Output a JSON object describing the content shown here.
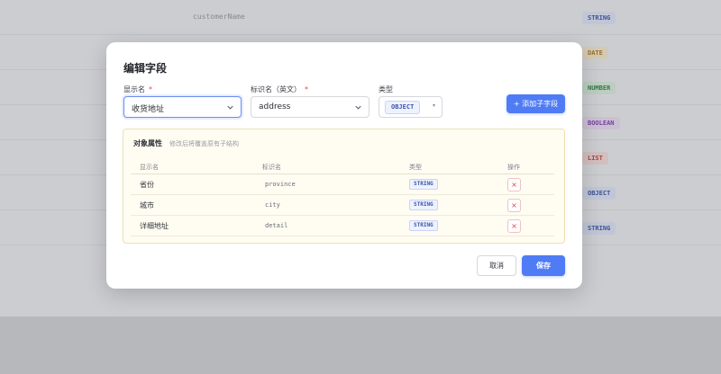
{
  "background": {
    "rows": [
      {
        "code": "customerName",
        "type": "STRING",
        "color": "#3d56a8",
        "bg": "#e4e9fb"
      },
      {
        "code": "",
        "type": "DATE",
        "color": "#b57a14",
        "bg": "#fbefd2"
      },
      {
        "code": "",
        "type": "NUMBER",
        "color": "#2f8a3e",
        "bg": "#dff2e2"
      },
      {
        "code": "",
        "type": "BOOLEAN",
        "color": "#8a3fb5",
        "bg": "#f0e2f8"
      },
      {
        "code": "",
        "type": "LIST",
        "color": "#c4423a",
        "bg": "#fbe1de"
      },
      {
        "code": "",
        "type": "OBJECT",
        "color": "#3d56a8",
        "bg": "#e4e9fb"
      },
      {
        "code": "",
        "type": "STRING",
        "color": "#3d56a8",
        "bg": "#e4e9fb"
      }
    ]
  },
  "modal": {
    "title": "编辑字段",
    "display_name_label": "显示名",
    "display_name_value": "收货地址",
    "key_label": "标识名（英文）",
    "key_value": "address",
    "type_label": "类型",
    "type_value": "OBJECT",
    "required_mark": "*",
    "add_child_button": "+ 添加子字段",
    "panel": {
      "title": "对象属性",
      "subtitle": "修改后将覆盖原有子结构",
      "columns": [
        "显示名",
        "标识名",
        "类型",
        "操作"
      ],
      "rows": [
        {
          "name": "省份",
          "key": "province",
          "type": "STRING"
        },
        {
          "name": "城市",
          "key": "city",
          "type": "STRING"
        },
        {
          "name": "详细地址",
          "key": "detail",
          "type": "STRING"
        }
      ],
      "delete_glyph": "×"
    },
    "cancel_button": "取消",
    "save_button": "保存"
  },
  "colors": {
    "primary": "#4f7cf5",
    "danger": "#d64545",
    "panel_bg": "#fffcf2"
  }
}
